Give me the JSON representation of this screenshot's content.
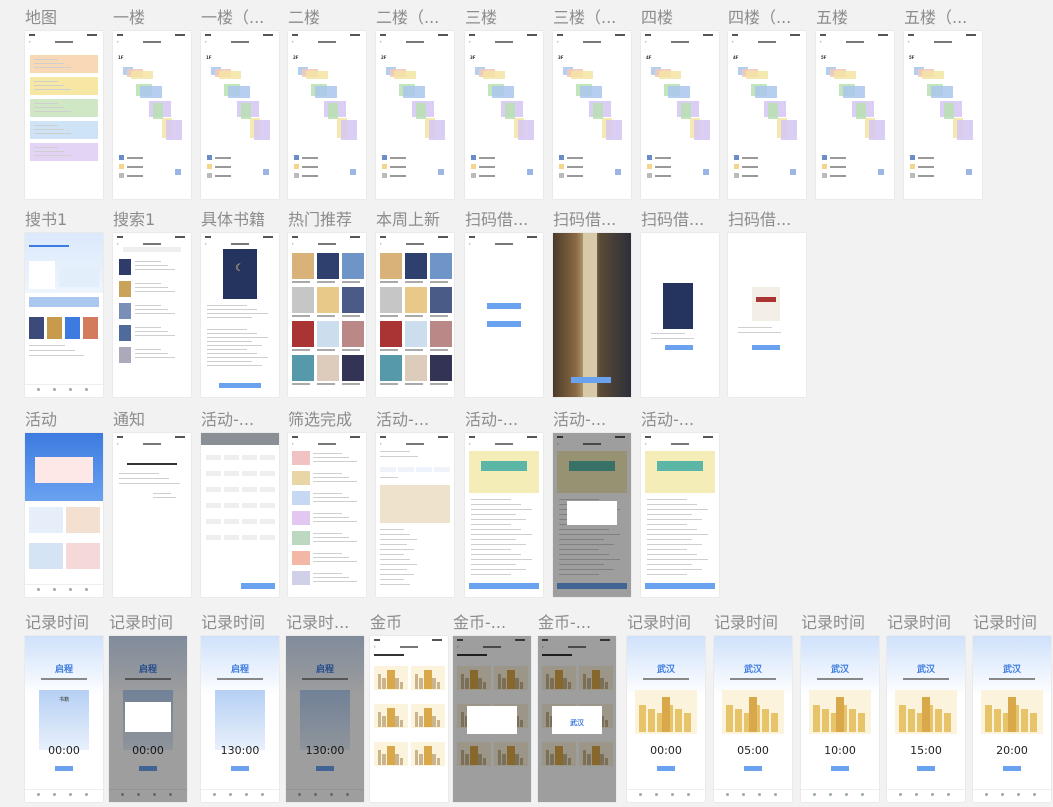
{
  "rows": [
    {
      "frames": [
        {
          "label": "地图",
          "type": "map-index"
        },
        {
          "label": "一楼",
          "type": "floor",
          "floor": "1F"
        },
        {
          "label": "一楼（...",
          "type": "floor",
          "floor": "1F"
        },
        {
          "label": "二楼",
          "type": "floor",
          "floor": "2F"
        },
        {
          "label": "二楼（...",
          "type": "floor",
          "floor": "2F"
        },
        {
          "label": "三楼",
          "type": "floor",
          "floor": "3F"
        },
        {
          "label": "三楼（...",
          "type": "floor",
          "floor": "3F"
        },
        {
          "label": "四楼",
          "type": "floor",
          "floor": "4F"
        },
        {
          "label": "四楼（...",
          "type": "floor",
          "floor": "4F"
        },
        {
          "label": "五楼",
          "type": "floor",
          "floor": "5F"
        },
        {
          "label": "五楼（...",
          "type": "floor",
          "floor": "5F"
        }
      ]
    },
    {
      "frames": [
        {
          "label": "搜书1",
          "type": "home"
        },
        {
          "label": "搜索1",
          "type": "search"
        },
        {
          "label": "具体书籍",
          "type": "book"
        },
        {
          "label": "热门推荐",
          "type": "grid"
        },
        {
          "label": "本周上新",
          "type": "grid"
        },
        {
          "label": "扫码借...",
          "type": "scan-blank"
        },
        {
          "label": "扫码借...",
          "type": "scan-camera"
        },
        {
          "label": "扫码借...",
          "type": "scan-result"
        },
        {
          "label": "扫码借...",
          "type": "scan-result2"
        }
      ]
    },
    {
      "frames": [
        {
          "label": "活动",
          "type": "activity"
        },
        {
          "label": "通知",
          "type": "notice"
        },
        {
          "label": "活动-...",
          "type": "filter"
        },
        {
          "label": "筛选完成",
          "type": "list"
        },
        {
          "label": "活动-...",
          "type": "tags"
        },
        {
          "label": "活动-...",
          "type": "event"
        },
        {
          "label": "活动-...",
          "type": "event-modal"
        },
        {
          "label": "活动-...",
          "type": "event"
        }
      ]
    },
    {
      "frames": [
        {
          "label": "记录时间",
          "type": "timer",
          "city": "启程",
          "time": "00:00",
          "book": "书籍"
        },
        {
          "label": "记录时间",
          "type": "timer-modal",
          "city": "启程",
          "time": "00:00"
        },
        {
          "label": "记录时间",
          "type": "timer",
          "city": "启程",
          "time": "130:00"
        },
        {
          "label": "记录时...",
          "type": "timer-dark",
          "city": "启程",
          "time": "130:00"
        },
        {
          "label": "金币",
          "type": "coins"
        },
        {
          "label": "金币-...",
          "type": "coins-modal"
        },
        {
          "label": "金币-...",
          "type": "coins-modal2",
          "city": "武汉"
        },
        {
          "label": "记录时间",
          "type": "timer-city",
          "city": "武汉",
          "time": "00:00"
        },
        {
          "label": "记录时间",
          "type": "timer-city",
          "city": "武汉",
          "time": "05:00"
        },
        {
          "label": "记录时间",
          "type": "timer-city",
          "city": "武汉",
          "time": "10:00"
        },
        {
          "label": "记录时间",
          "type": "timer-city",
          "city": "武汉",
          "time": "15:00"
        },
        {
          "label": "记录时间",
          "type": "timer-city",
          "city": "武汉",
          "time": "20:00"
        }
      ]
    }
  ],
  "colors": {
    "accent": "#3d7be0",
    "button": "#6aa2f0",
    "floor_green": "#b9e0b0",
    "floor_blue": "#a9c7ef",
    "floor_purple": "#d5c6f2",
    "floor_yellow": "#f5e4a3"
  }
}
